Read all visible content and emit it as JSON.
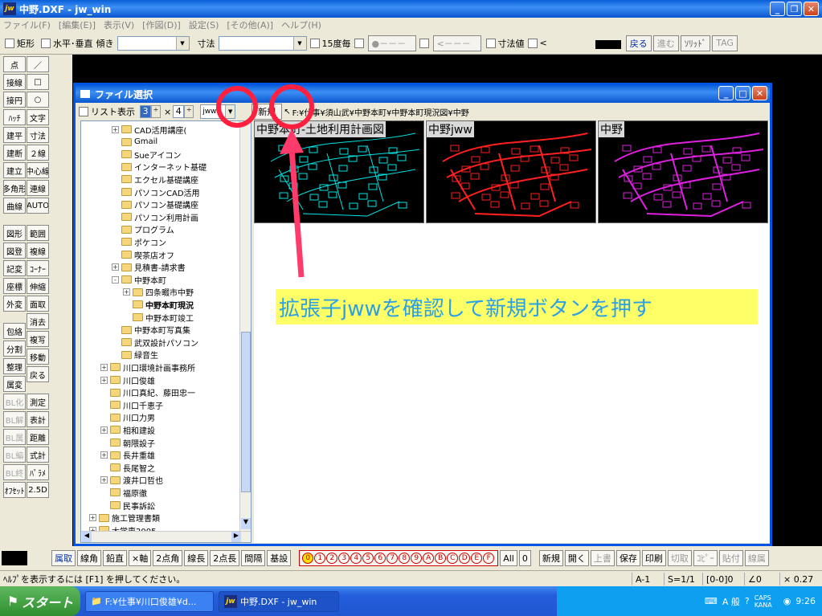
{
  "window": {
    "title": "中野.DXF - jw_win",
    "icon": "jw"
  },
  "menu": [
    "ファイル(F)",
    "[編集(E)]",
    "表示(V)",
    "[作図(D)]",
    "設定(S)",
    "[その他(A)]",
    "ヘルプ(H)"
  ],
  "toolbar1": {
    "rect": "矩形",
    "hv": "水平･垂直",
    "tilt": "傾き",
    "dim": "寸法",
    "deg15": "15度毎",
    "dimval": "寸法値",
    "lt": "<",
    "dots1": "●－－－",
    "dots2": "<－－－",
    "back": "戻る",
    "fwd": "進む",
    "solid": "ｿﾘｯﾄﾞ",
    "tag": "TAG"
  },
  "leftbar": {
    "col1": [
      "点",
      "接線",
      "接円",
      "ﾊｯﾁ",
      "建平",
      "建断",
      "建立",
      "多角形",
      "曲線",
      "図形",
      "図登",
      "記変",
      "座標",
      "外変",
      "包絡",
      "分割",
      "整理",
      "属変",
      "BL化",
      "BL解",
      "BL属",
      "BL編",
      "BL終",
      "ｵﾌｾｯﾄ"
    ],
    "col2": [
      "／",
      "□",
      "○",
      "文字",
      "寸法",
      "２線",
      "中心線",
      "連線",
      "AUTO",
      "範囲",
      "複線",
      "ｺｰﾅｰ",
      "伸縮",
      "面取",
      "消去",
      "複写",
      "移動",
      "戻る",
      "測定",
      "表計",
      "距離",
      "式計",
      "ﾊﾟﾗﾒ",
      "2.5D"
    ]
  },
  "dialog": {
    "title": "ファイル選択",
    "list_view": "リスト表示",
    "cols": "3",
    "times": "×",
    "rows": "4",
    "ext": "jww",
    "new_button": "新規",
    "path": "F:¥仕事¥須山武¥中野本町¥中野本町現況図¥中野"
  },
  "tree": [
    {
      "label": "CAD活用講座(",
      "level": 2,
      "exp": "+"
    },
    {
      "label": "Gmail",
      "level": 2
    },
    {
      "label": "Sueアイコン",
      "level": 2
    },
    {
      "label": "インターネット基礎",
      "level": 2
    },
    {
      "label": "エクセル基礎講座",
      "level": 2
    },
    {
      "label": "パソコンCAD活用",
      "level": 2
    },
    {
      "label": "パソコン基礎講座",
      "level": 2
    },
    {
      "label": "パソコン利用計画",
      "level": 2
    },
    {
      "label": "プログラム",
      "level": 2
    },
    {
      "label": "ポケコン",
      "level": 2
    },
    {
      "label": "喫茶店オフ",
      "level": 2
    },
    {
      "label": "見積書-請求書",
      "level": 2,
      "exp": "+"
    },
    {
      "label": "中野本町",
      "level": 2,
      "exp": "-"
    },
    {
      "label": "四条畷市中野",
      "level": 3,
      "exp": "+"
    },
    {
      "label": "中野本町現況",
      "level": 3,
      "bold": true
    },
    {
      "label": "中野本町竣工",
      "level": 3
    },
    {
      "label": "中野本町写真集",
      "level": 2
    },
    {
      "label": "武双設計パソコン",
      "level": 2
    },
    {
      "label": "緑音生",
      "level": 2
    },
    {
      "label": "川口環境計画事務所",
      "level": 1,
      "exp": "+"
    },
    {
      "label": "川口俊雄",
      "level": 1,
      "exp": "+"
    },
    {
      "label": "川口真紀、藤田忠一",
      "level": 1
    },
    {
      "label": "川口千恵子",
      "level": 1
    },
    {
      "label": "川口力男",
      "level": 1
    },
    {
      "label": "相和建設",
      "level": 1,
      "exp": "+"
    },
    {
      "label": "朝隈設子",
      "level": 1
    },
    {
      "label": "長井重雄",
      "level": 1,
      "exp": "+"
    },
    {
      "label": "長尾智之",
      "level": 1
    },
    {
      "label": "渡井口哲也",
      "level": 1,
      "exp": "+"
    },
    {
      "label": "福原徹",
      "level": 1
    },
    {
      "label": "民事訴訟",
      "level": 1
    },
    {
      "label": "施工管理書類",
      "level": 0,
      "exp": "+"
    },
    {
      "label": "大学専2005",
      "level": 0,
      "exp": "+"
    }
  ],
  "thumbs": [
    {
      "label": "中野本町-土地利用計画図",
      "color": "#00e5e5"
    },
    {
      "label": "中野jww",
      "color": "#ff2020"
    },
    {
      "label": "中野",
      "color": "#e020e0"
    }
  ],
  "annotation": "拡張子jwwを確認して新規ボタンを押す",
  "colors": {
    "accent": "#0055e5",
    "circle": "#ff2040",
    "arrow": "#ff3b6b",
    "annot_bg": "#ffff66",
    "annot_text": "#2aa0e6"
  },
  "bottombar": {
    "left": [
      "属取",
      "線角",
      "鉛直",
      "×軸",
      "2点角",
      "線長",
      "2点長",
      "間隔",
      "基設"
    ],
    "layers": [
      "0",
      "1",
      "2",
      "3",
      "4",
      "5",
      "6",
      "7",
      "8",
      "9",
      "A",
      "B",
      "C",
      "D",
      "E",
      "F"
    ],
    "all": "All",
    "zero": "0",
    "right": [
      "新規",
      "開く",
      "上書",
      "保存",
      "印刷",
      "切取",
      "ｺﾋﾟｰ",
      "貼付",
      "線属"
    ]
  },
  "status": {
    "help": "ﾍﾙﾌﾟを表示するには [F1] を押してください。",
    "a": "A-1",
    "s": "S=1/1",
    "layer": "[0-0]0",
    "angle": "∠0",
    "zoom": "× 0.27"
  },
  "taskbar": {
    "start": "スタート",
    "tasks": [
      "F:¥仕事¥川口俊雄¥d...",
      "中野.DXF - jw_win"
    ],
    "tray": "A 般",
    "caps": "CAPS KANA",
    "time": "9:26"
  }
}
